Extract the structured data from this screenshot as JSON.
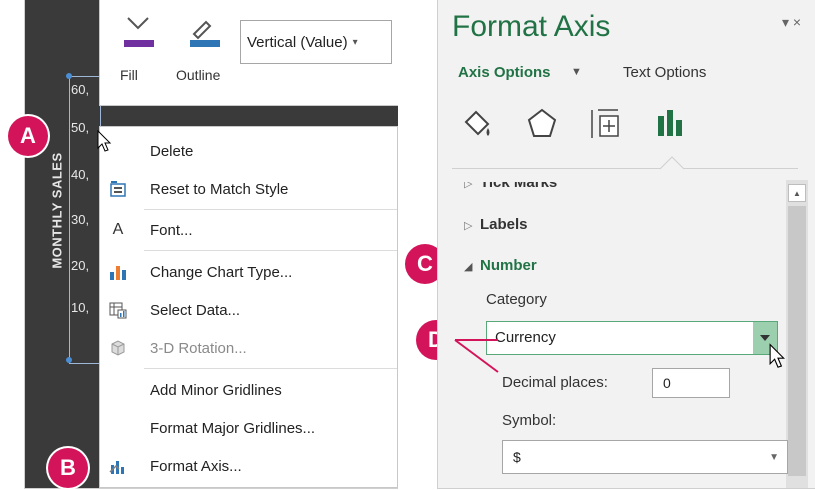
{
  "left": {
    "axis_title": "MONTHLY SALES",
    "tick_labels": [
      "60,",
      "50,",
      "40,",
      "30,",
      "20,",
      "10,"
    ],
    "toolbar": {
      "fill_label": "Fill",
      "outline_label": "Outline",
      "element_dropdown": "Vertical (Value)"
    },
    "menu": [
      {
        "label": "Delete",
        "icon": "none"
      },
      {
        "label": "Reset to Match Style",
        "icon": "reset-style-icon"
      },
      {
        "label": "Font...",
        "icon": "font-icon"
      },
      {
        "label": "Change Chart Type...",
        "icon": "chart-type-icon"
      },
      {
        "label": "Select Data...",
        "icon": "select-data-icon"
      },
      {
        "label": "3-D Rotation...",
        "icon": "rotation-3d-icon",
        "disabled": true
      },
      {
        "label": "Add Minor Gridlines",
        "icon": "none"
      },
      {
        "label": "Format Major Gridlines...",
        "icon": "none"
      },
      {
        "label": "Format Axis...",
        "icon": "format-axis-icon"
      }
    ]
  },
  "callouts": [
    "A",
    "B",
    "C",
    "D"
  ],
  "pane": {
    "title": "Format Axis",
    "controls": "▾ ×",
    "axis_options_tab": "Axis Options",
    "text_options_tab": "Text Options",
    "icons": [
      "fill-line-icon",
      "effects-icon",
      "size-properties-icon",
      "axis-options-icon"
    ],
    "sections": {
      "tick_marks": "Tick Marks",
      "labels": "Labels",
      "number": "Number"
    },
    "category_label": "Category",
    "category_value": "Currency",
    "decimal_label": "Decimal places:",
    "decimal_value": "0",
    "symbol_label": "Symbol:",
    "symbol_value": "$"
  },
  "colors": {
    "accent_green": "#217346",
    "callout_magenta": "#d4145a",
    "chart_dark": "#3a3a3a"
  }
}
